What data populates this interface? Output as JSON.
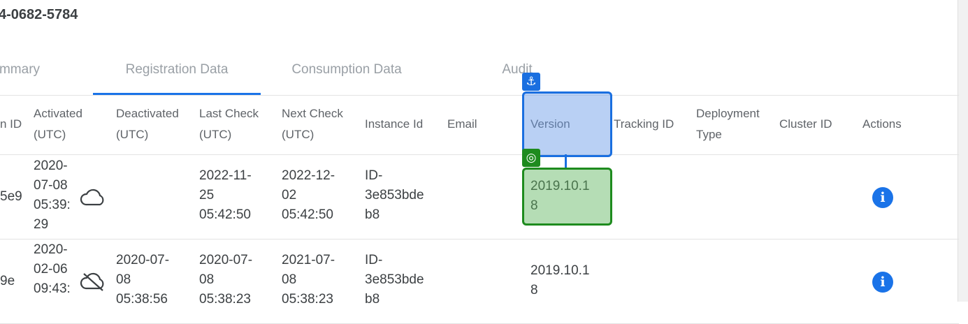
{
  "page": {
    "license_title": "4-0682-5784"
  },
  "tabs": [
    {
      "label": "mmary",
      "active": false
    },
    {
      "label": "Registration Data",
      "active": true
    },
    {
      "label": "Consumption Data",
      "active": false
    },
    {
      "label": "Audit",
      "active": false
    }
  ],
  "table": {
    "headers": {
      "registration_id": "n ID",
      "activated": [
        "Activated",
        "(UTC)"
      ],
      "deactivated": [
        "Deactivated",
        "(UTC)"
      ],
      "last_check": [
        "Last Check",
        "(UTC)"
      ],
      "next_check": [
        "Next Check",
        "(UTC)"
      ],
      "instance_id": "Instance Id",
      "email": "Email",
      "version": "Version",
      "tracking_id": "Tracking ID",
      "deployment_type": [
        "Deployment",
        "Type"
      ],
      "cluster_id": "Cluster ID",
      "actions": "Actions"
    },
    "rows": [
      {
        "registration_id": "5e9",
        "activated": [
          "2020-",
          "07-08",
          "05:39:",
          "29"
        ],
        "status_icon": "cloud-icon",
        "deactivated": [],
        "last_check": [
          "2022-11-",
          "25",
          "05:42:50"
        ],
        "next_check": [
          "2022-12-",
          "02",
          "05:42:50"
        ],
        "instance_id": [
          "ID-",
          "3e853bde",
          "b8"
        ],
        "version": [
          "2019.10.1",
          "8"
        ],
        "action_icon": "info-icon"
      },
      {
        "registration_id": "9e",
        "activated": [
          "2020-",
          "02-06",
          "09:43:"
        ],
        "status_icon": "cloud-off-icon",
        "deactivated": [
          "2020-07-",
          "08",
          "05:38:56"
        ],
        "last_check": [
          "2020-07-",
          "08",
          "05:38:23"
        ],
        "next_check": [
          "2021-07-",
          "08",
          "05:38:23"
        ],
        "instance_id": [
          "ID-",
          "3e853bde",
          "b8"
        ],
        "version": [
          "2019.10.1",
          "8"
        ],
        "action_icon": "info-icon"
      }
    ]
  },
  "overlay": {
    "anchor_icon": "⚓",
    "target_icon": "◎",
    "header_color": "#1a6fe0",
    "cell_color": "#1e8b1e"
  },
  "colors": {
    "accent": "#1a73e8",
    "text": "#3c4043",
    "muted": "#9aa0a6"
  }
}
